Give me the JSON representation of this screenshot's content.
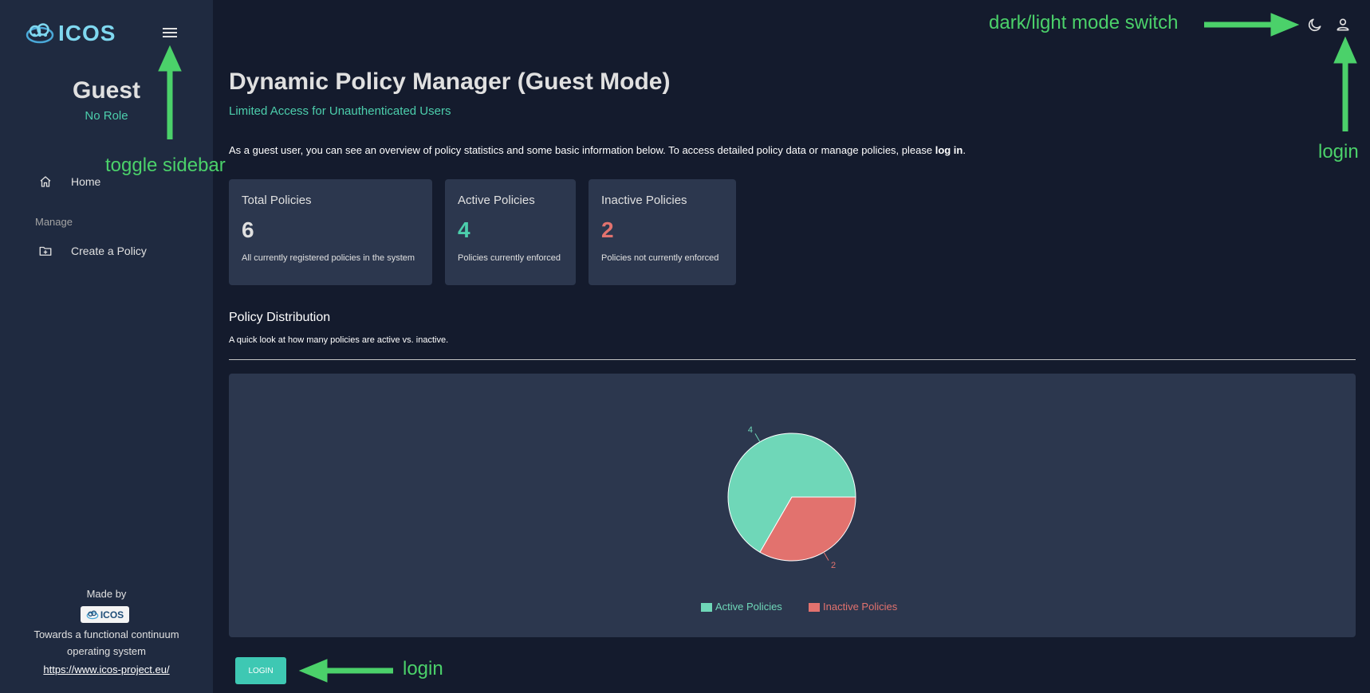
{
  "sidebar": {
    "logo_text": "ICOS",
    "profile": {
      "name": "Guest",
      "role": "No Role"
    },
    "nav": [
      {
        "label": "Home",
        "icon": "home-icon"
      }
    ],
    "section_label": "Manage",
    "manage_items": [
      {
        "label": "Create a Policy",
        "icon": "folder-plus-icon"
      }
    ],
    "footer": {
      "made_by": "Made by",
      "logo_text": "ICOS",
      "tagline": "Towards a functional continuum operating system",
      "link": "https://www.icos-project.eu/"
    }
  },
  "topbar": {
    "icons": [
      "moon-icon",
      "person-icon"
    ]
  },
  "main": {
    "title": "Dynamic Policy Manager (Guest Mode)",
    "subtitle": "Limited Access for Unauthenticated Users",
    "intro_text": "As a guest user, you can see an overview of policy statistics and some basic information below. To access detailed policy data or manage policies, please ",
    "intro_bold": "log in",
    "intro_end": ".",
    "cards": [
      {
        "title": "Total Policies",
        "value": "6",
        "desc": "All currently registered policies in the system",
        "color": "#e0e0e0"
      },
      {
        "title": "Active Policies",
        "value": "4",
        "desc": "Policies currently enforced",
        "color": "#4cceac"
      },
      {
        "title": "Inactive Policies",
        "value": "2",
        "desc": "Policies not currently enforced",
        "color": "#e2726e"
      }
    ],
    "distribution": {
      "title": "Policy Distribution",
      "subtitle": "A quick look at how many policies are active vs. inactive."
    },
    "login_button": "LOGIN"
  },
  "chart_data": {
    "type": "pie",
    "categories": [
      "Active Policies",
      "Inactive Policies"
    ],
    "values": [
      4,
      2
    ],
    "colors": [
      "#6fd7b8",
      "#e2726e"
    ],
    "data_labels": [
      "4",
      "2"
    ],
    "legend": "bottom-center"
  },
  "annotations": {
    "mode_switch": "dark/light mode switch",
    "login_top": "login",
    "toggle_sidebar": "toggle sidebar",
    "login_bottom": "login"
  },
  "colors": {
    "accent": "#4cceac",
    "annotation": "#4bd16a",
    "background": "#141b2d",
    "sidebar": "#1f2a40"
  }
}
